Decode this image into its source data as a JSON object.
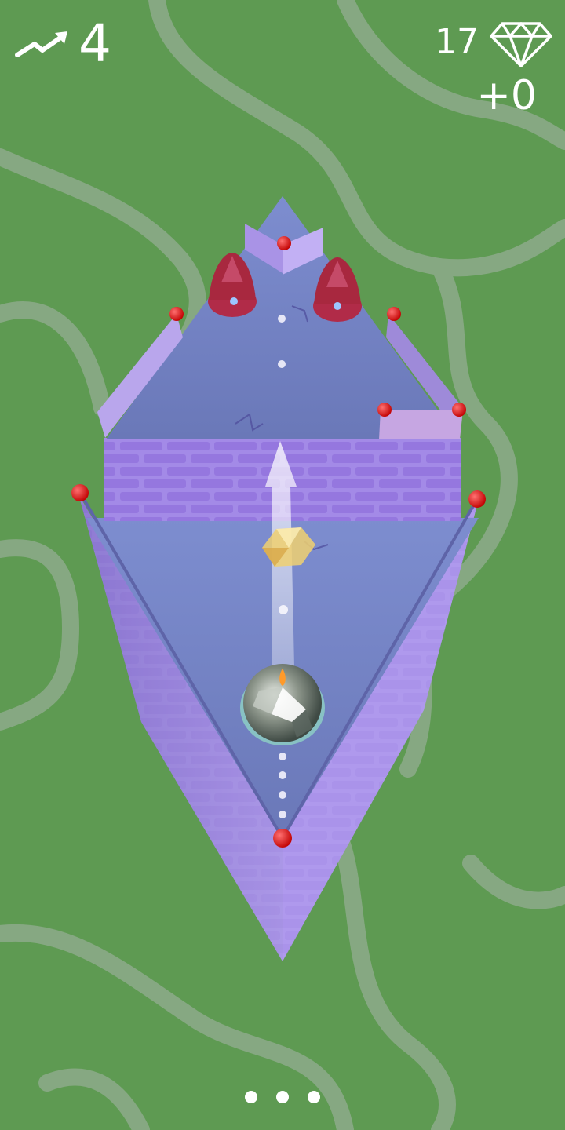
{
  "hud": {
    "level_icon": "trend-arrow-icon",
    "level": "4",
    "gems": "17",
    "gem_icon": "diamond-icon",
    "gem_delta": "+0"
  },
  "pager": {
    "dots": 3
  },
  "colors": {
    "grass": "#5e9a52",
    "path": "#86a882",
    "floor": "#6f7fc0",
    "brick": "#9a7fe0",
    "spike": "#b2334e",
    "post": "#e01818",
    "ball": "#8a9588",
    "gem": "#f0d070"
  }
}
